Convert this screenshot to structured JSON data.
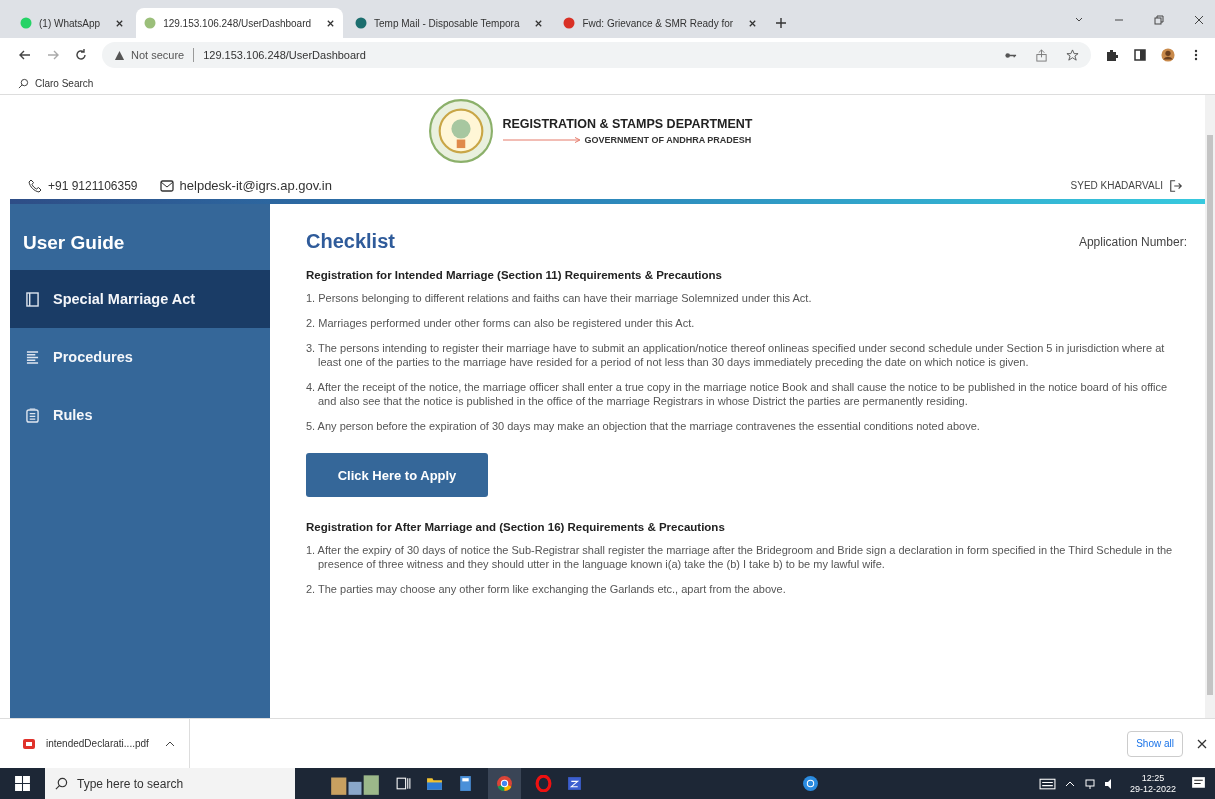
{
  "browser": {
    "tabs": [
      {
        "title": "(1) WhatsApp",
        "selected": false
      },
      {
        "title": "129.153.106.248/UserDashboard",
        "selected": true
      },
      {
        "title": "Temp Mail - Disposable Tempora",
        "selected": false
      },
      {
        "title": "Fwd: Grievance & SMR Ready for",
        "selected": false
      }
    ],
    "security": "Not secure",
    "url": "129.153.106.248/UserDashboard",
    "bookmark": "Claro Search"
  },
  "header": {
    "title": "REGISTRATION & STAMPS DEPARTMENT",
    "subtitle": "GOVERNMENT OF ANDHRA PRADESH",
    "phone": "+91 9121106359",
    "email": "helpdesk-it@igrs.ap.gov.in",
    "user": "SYED KHADARVALI"
  },
  "sidebar": {
    "title": "User Guide",
    "items": [
      {
        "label": "Special Marriage Act",
        "selected": true
      },
      {
        "label": "Procedures",
        "selected": false
      },
      {
        "label": "Rules",
        "selected": false
      }
    ]
  },
  "checklist": {
    "title": "Checklist",
    "application_number_label": "Application Number:",
    "sections": [
      {
        "heading": "Registration for Intended Marriage (Section 11) Requirements & Precautions",
        "items": [
          "1. Persons belonging to different relations and faiths can have their marriage Solemnized under this Act.",
          "2. Marriages performed under other forms can also be registered under this Act.",
          "3. The persons intending to register their marriage have to submit an application/notice thereof onlineas specified under second schedule under Section 5 in jurisdiction where at least one of the parties to the marriage have resided for a period of not less than 30 days immediately preceding the date on which notice is given.",
          "4. After the receipt of the notice, the marriage officer shall enter a true copy in the marriage notice Book and shall cause the notice to be published in the notice board of his office and also see that the notice is published in the office of the marriage Registrars in whose District the parties are permanently residing.",
          "5. Any person before the expiration of 30 days may make an objection that the marriage contravenes the essential conditions noted above."
        ],
        "button": "Click Here to Apply"
      },
      {
        "heading": "Registration for After Marriage and (Section 16) Requirements & Precautions",
        "items": [
          "1. After the expiry of 30 days of notice the Sub-Registrar shall register the marriage after the Bridegroom and Bride sign a declaration in form specified in the Third Schedule in the presence of three witness and they should utter in the language known i(a) take the (b) I take b) to be my lawful wife.",
          "2. The parties may choose any other form like exchanging the Garlands etc., apart from the above."
        ]
      }
    ]
  },
  "downloads": {
    "file": "intendedDeclarati....pdf",
    "show_all": "Show all"
  },
  "taskbar": {
    "search_placeholder": "Type here to search",
    "time": "12:25",
    "date": "29-12-2022"
  }
}
